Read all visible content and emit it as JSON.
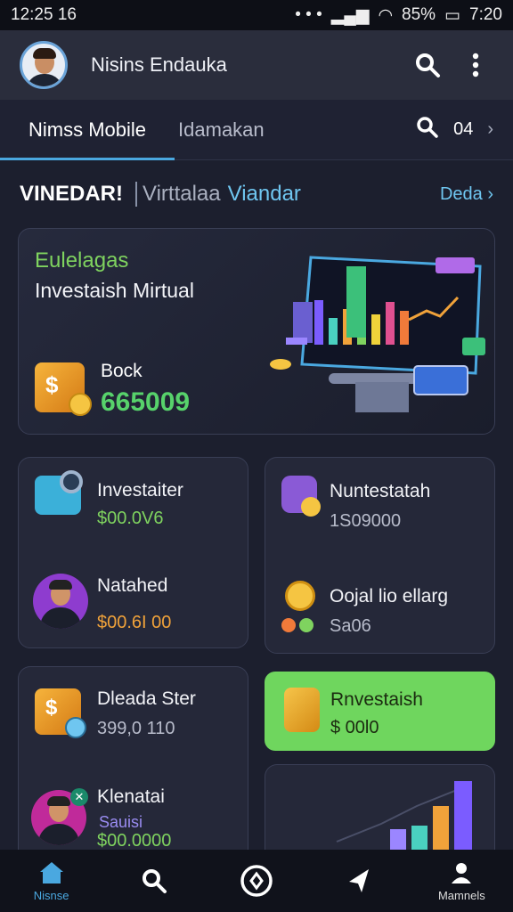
{
  "status_bar": {
    "time_left": "12:25 16",
    "battery": "85%",
    "time_right": "7:20"
  },
  "app_bar": {
    "title": "Nisins Endauka"
  },
  "tabs": [
    {
      "label": "Nimss Mobile"
    },
    {
      "label": "Idamakan"
    }
  ],
  "tab_extra": {
    "count": "04"
  },
  "section": {
    "title": "VINEDAR!",
    "subtitle_gray": "Virttalaa",
    "subtitle_blue": "Viandar",
    "more_label": "Deda"
  },
  "hero": {
    "kicker": "Eulelagas",
    "heading": "Investaish Mirtual",
    "stock_label": "Bock",
    "stock_value": "665009"
  },
  "cards": [
    {
      "title": "Investaiter",
      "value": "$00.0V6"
    },
    {
      "title": "Nuntestatah",
      "value": "1S09000"
    },
    {
      "title": "Natahed",
      "value": "$00.6I 00"
    },
    {
      "title": "Oojal lio ellarg",
      "value": "Sa06"
    },
    {
      "title": "Dleada Ster",
      "value": "399,0 110"
    },
    {
      "title": "Rnvestaish",
      "value": "$ 00l0"
    },
    {
      "title": "Klenatai",
      "subtitle": "Sauisi",
      "value": "$00.0000"
    }
  ],
  "bottom_nav": [
    {
      "label": "Nisnse",
      "icon": "home-icon"
    },
    {
      "label": "",
      "icon": "search-icon"
    },
    {
      "label": "",
      "icon": "compass-icon"
    },
    {
      "label": "",
      "icon": "send-icon"
    },
    {
      "label": "Mamnels",
      "icon": "profile-icon"
    }
  ],
  "colors": {
    "accent": "#4aa8e0",
    "green": "#6fd65e",
    "orange": "#f0a23a",
    "background": "#1c1f2e"
  }
}
